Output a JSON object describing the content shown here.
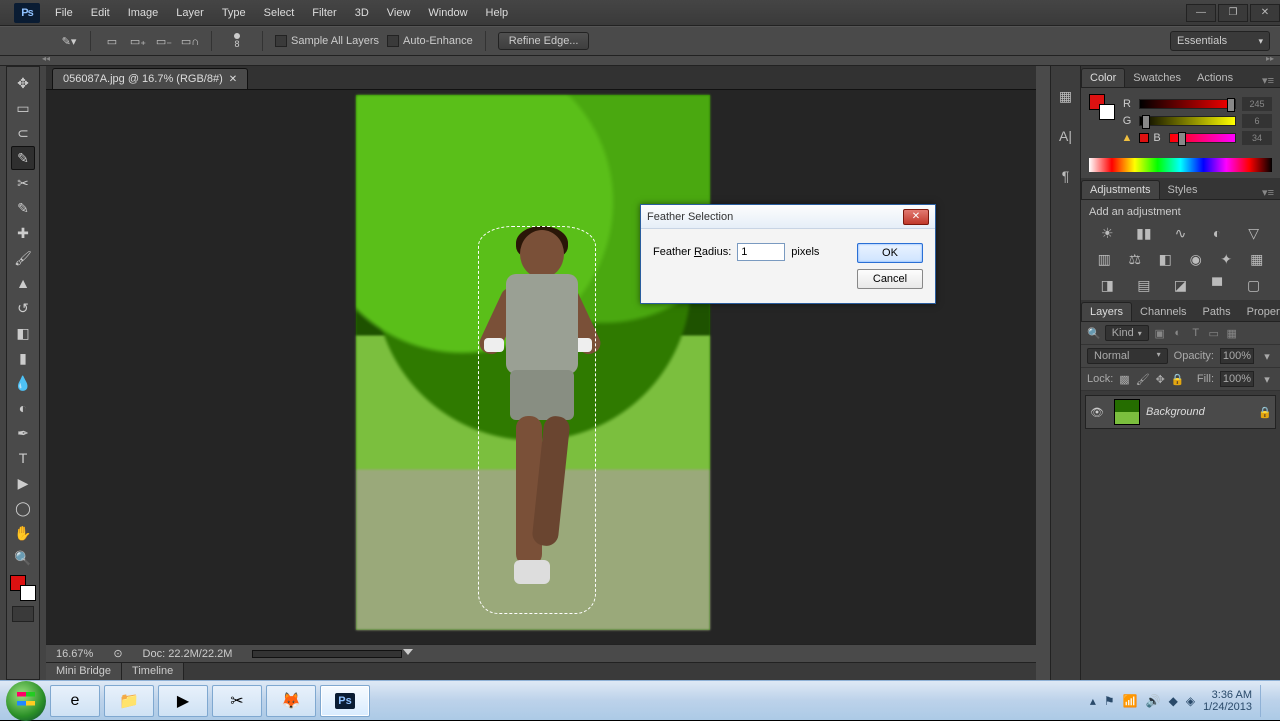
{
  "menubar": {
    "items": [
      "File",
      "Edit",
      "Image",
      "Layer",
      "Type",
      "Select",
      "Filter",
      "3D",
      "View",
      "Window",
      "Help"
    ]
  },
  "optionsbar": {
    "size_label": "8",
    "sample_all": "Sample All Layers",
    "auto_enhance": "Auto-Enhance",
    "refine_edge": "Refine Edge...",
    "workspace": "Essentials"
  },
  "document": {
    "tab_title": "056087A.jpg @ 16.7% (RGB/8#)",
    "zoom": "16.67%",
    "doc_info": "Doc: 22.2M/22.2M"
  },
  "bottom_tabs": {
    "mini_bridge": "Mini Bridge",
    "timeline": "Timeline"
  },
  "panels": {
    "color": {
      "tabs": [
        "Color",
        "Swatches",
        "Actions"
      ],
      "r": "245",
      "g": "6",
      "b": "34"
    },
    "adjustments": {
      "tabs": [
        "Adjustments",
        "Styles"
      ],
      "title": "Add an adjustment"
    },
    "layers": {
      "tabs": [
        "Layers",
        "Channels",
        "Paths",
        "Properties"
      ],
      "filter": "Kind",
      "blend": "Normal",
      "opacity_label": "Opacity:",
      "opacity_value": "100%",
      "lock_label": "Lock:",
      "fill_label": "Fill:",
      "fill_value": "100%",
      "layer_name": "Background"
    }
  },
  "dialog": {
    "title": "Feather Selection",
    "radius_label_pre": "Feather ",
    "radius_label_u": "R",
    "radius_label_post": "adius:",
    "radius_value": "1",
    "units": "pixels",
    "ok": "OK",
    "cancel": "Cancel"
  },
  "taskbar": {
    "time": "3:36 AM",
    "date": "1/24/2013"
  }
}
